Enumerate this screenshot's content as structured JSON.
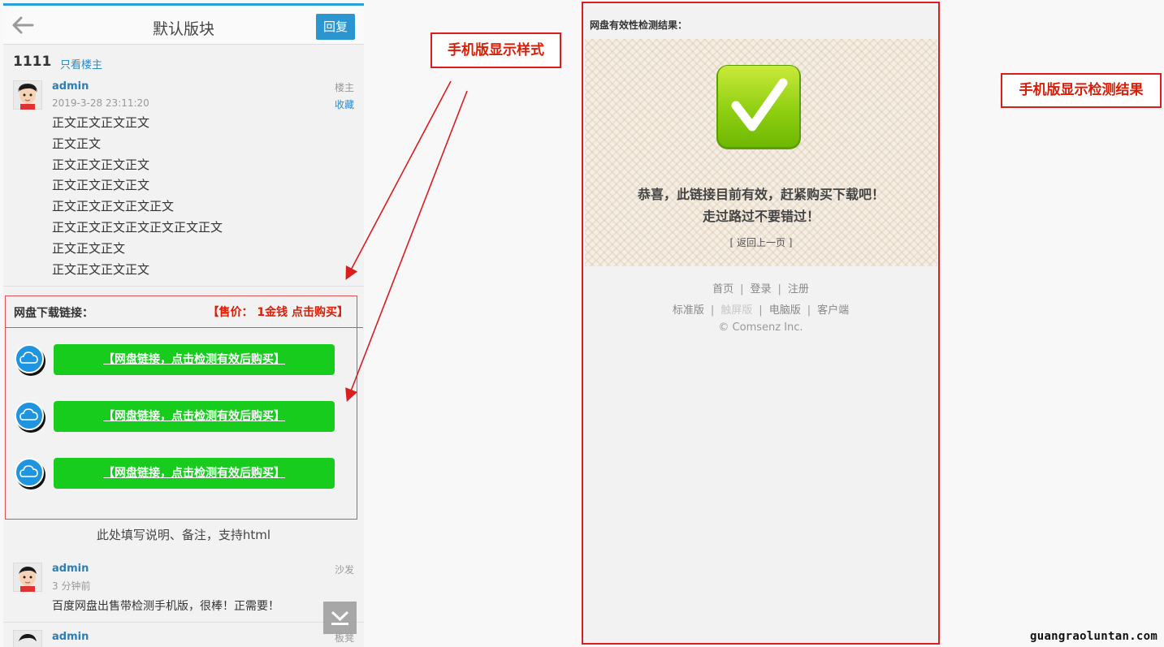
{
  "left_phone": {
    "header": {
      "title": "默认版块",
      "reply_label": "回复"
    },
    "thread": {
      "title": "1111",
      "only_author_label": "只看楼主"
    },
    "first_post": {
      "author": "admin",
      "time": "2019-3-28 23:11:20",
      "floor": "楼主",
      "favorite_label": "收藏",
      "body_lines": [
        "正文正文正文正文",
        "正文正文",
        "正文正文正文正文",
        "正文正文正文正文",
        "正文正文正文正文正文",
        "正文正文正文正文正文正文正文",
        "正文正文正文",
        "正文正文正文正文"
      ]
    },
    "pan": {
      "title": "网盘下载链接：",
      "price": "【售价： 1金钱 点击购买】",
      "links": [
        "【网盘链接，点击检测有效后购买】",
        "【网盘链接，点击检测有效后购买】",
        "【网盘链接，点击检测有效后购买】"
      ]
    },
    "note": "此处填写说明、备注，支持html",
    "reply_post": {
      "author": "admin",
      "time": "3 分钟前",
      "floor": "沙发",
      "body": "百度网盘出售带检测手机版，很棒！正需要！"
    },
    "next_post": {
      "author": "admin",
      "floor": "板凳"
    }
  },
  "annotations": {
    "mobile_style": "手机版显示样式",
    "mobile_result": "手机版显示检测结果"
  },
  "right_phone": {
    "heading": "网盘有效性检测结果：",
    "success_line1": "恭喜，此链接目前有效，赶紧购买下载吧！",
    "success_line2": "走过路过不要错过！",
    "back_link": "[ 返回上一页 ]",
    "footer_nav": [
      "首页",
      "登录",
      "注册"
    ],
    "footer_versions": [
      "标准版",
      "触屏版",
      "电脑版",
      "客户端"
    ],
    "copyright": "© Comsenz Inc."
  },
  "watermark": "guangraoluntan.com",
  "colors": {
    "accent": "#2a95cf",
    "link_green": "#18cc1e",
    "alert_red": "#d81e06"
  },
  "icons": [
    "back-arrow-icon",
    "avatar-icon",
    "cloud-icon",
    "check-icon",
    "chevron-down-icon"
  ]
}
